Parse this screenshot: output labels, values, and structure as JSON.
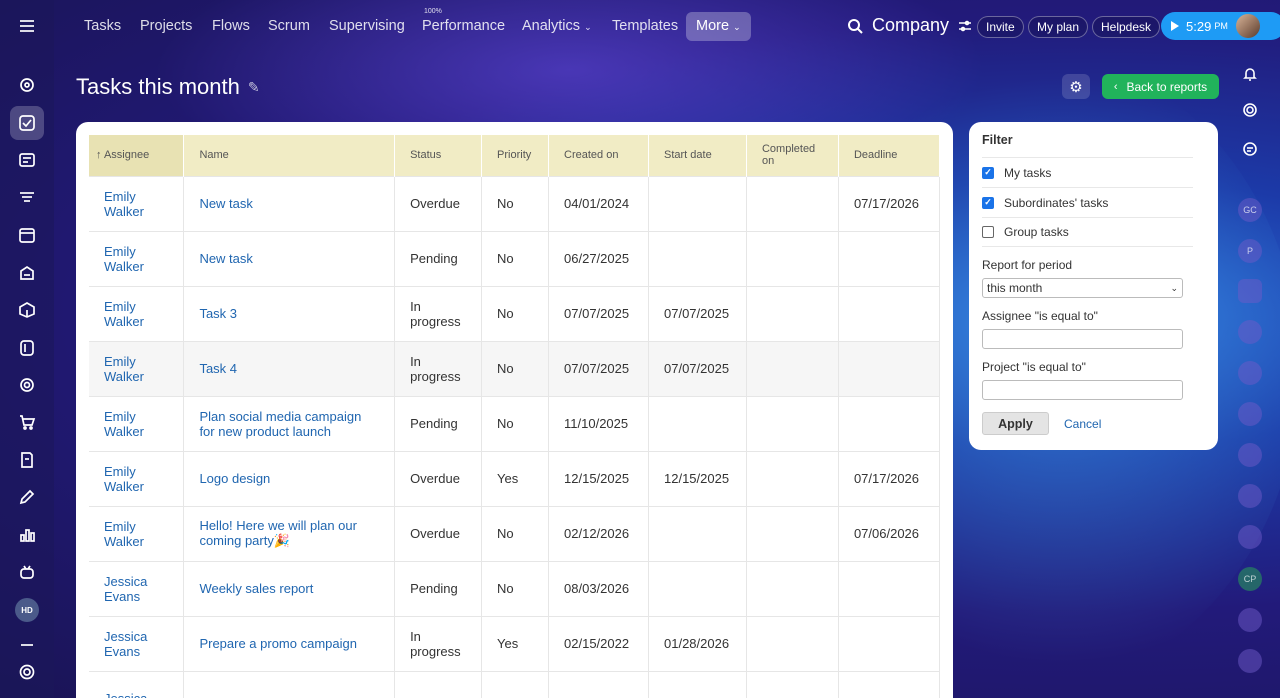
{
  "nav": {
    "items": [
      "Tasks",
      "Projects",
      "Flows",
      "Scrum",
      "Supervising",
      "Performance",
      "Analytics",
      "Templates"
    ],
    "performance_badge": "100%",
    "more_label": "More",
    "company_label": "Company",
    "invite_label": "Invite",
    "myplan_label": "My plan",
    "helpdesk_label": "Helpdesk",
    "clock_time": "5:29",
    "clock_ampm": "PM"
  },
  "sidebar": {
    "avatar_initials": "HD"
  },
  "page": {
    "title": "Tasks this month",
    "back_label": "Back to reports"
  },
  "table": {
    "headers": [
      "Assignee",
      "Name",
      "Status",
      "Priority",
      "Created on",
      "Start date",
      "Completed on",
      "Deadline"
    ],
    "sort_indicator": "↑",
    "rows": [
      {
        "assignee": "Emily Walker",
        "name": "New task",
        "status": "Overdue",
        "priority": "No",
        "created": "04/01/2024",
        "start": "",
        "completed": "",
        "deadline": "07/17/2026"
      },
      {
        "assignee": "Emily Walker",
        "name": "New task",
        "status": "Pending",
        "priority": "No",
        "created": "06/27/2025",
        "start": "",
        "completed": "",
        "deadline": ""
      },
      {
        "assignee": "Emily Walker",
        "name": "Task 3",
        "status": "In progress",
        "priority": "No",
        "created": "07/07/2025",
        "start": "07/07/2025",
        "completed": "",
        "deadline": ""
      },
      {
        "assignee": "Emily Walker",
        "name": "Task 4",
        "status": "In progress",
        "priority": "No",
        "created": "07/07/2025",
        "start": "07/07/2025",
        "completed": "",
        "deadline": ""
      },
      {
        "assignee": "Emily Walker",
        "name": "Plan social media campaign for new product launch",
        "status": "Pending",
        "priority": "No",
        "created": "11/10/2025",
        "start": "",
        "completed": "",
        "deadline": ""
      },
      {
        "assignee": "Emily Walker",
        "name": "Logo design",
        "status": "Overdue",
        "priority": "Yes",
        "created": "12/15/2025",
        "start": "12/15/2025",
        "completed": "",
        "deadline": "07/17/2026"
      },
      {
        "assignee": "Emily Walker",
        "name": "Hello! Here we will plan our coming party🎉",
        "status": "Overdue",
        "priority": "No",
        "created": "02/12/2026",
        "start": "",
        "completed": "",
        "deadline": "07/06/2026"
      },
      {
        "assignee": "Jessica Evans",
        "name": "Weekly sales report",
        "status": "Pending",
        "priority": "No",
        "created": "08/03/2026",
        "start": "",
        "completed": "",
        "deadline": ""
      },
      {
        "assignee": "Jessica Evans",
        "name": "Prepare a promo campaign",
        "status": "In progress",
        "priority": "Yes",
        "created": "02/15/2022",
        "start": "01/28/2026",
        "completed": "",
        "deadline": ""
      },
      {
        "assignee": "Jessica",
        "name": "",
        "status": "",
        "priority": "",
        "created": "",
        "start": "",
        "completed": "",
        "deadline": ""
      }
    ]
  },
  "filter": {
    "title": "Filter",
    "options": [
      {
        "label": "My tasks",
        "checked": true
      },
      {
        "label": "Subordinates' tasks",
        "checked": true
      },
      {
        "label": "Group tasks",
        "checked": false
      }
    ],
    "period_label": "Report for period",
    "period_value": "this month",
    "assignee_label": "Assignee \"is equal to\"",
    "project_label": "Project \"is equal to\"",
    "apply_label": "Apply",
    "cancel_label": "Cancel"
  },
  "rightbar": {
    "avatars": [
      "GC",
      "P",
      "CP"
    ]
  },
  "colors": {
    "accent_green": "#21b35b",
    "clock_blue": "#1e9bf5",
    "link_blue": "#2066b0",
    "header_yellow": "#f1ecc5"
  }
}
